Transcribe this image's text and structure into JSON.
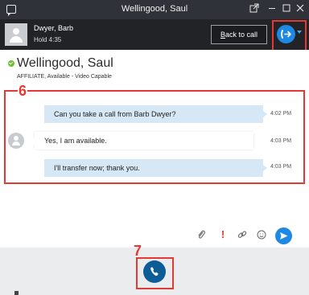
{
  "window": {
    "title": "Wellingood, Saul"
  },
  "call_bar": {
    "caller_name": "Dwyer, Barb",
    "hold_status": "Hold 4:35",
    "back_to_call_prefix": "B",
    "back_to_call_rest": "ack to call"
  },
  "contact": {
    "name": "Wellingood, Saul",
    "status_line": "AFFILIATE,  Available - Video Capable",
    "presence_color": "#6cbf2e"
  },
  "annotations": {
    "step6": "6",
    "step7": "7",
    "highlight_color": "#e53935"
  },
  "messages": [
    {
      "direction": "out",
      "text": "Can you take a call from Barb Dwyer?",
      "time": "4:02 PM"
    },
    {
      "direction": "in",
      "text": "Yes, I am available.",
      "time": "4:03 PM"
    },
    {
      "direction": "out",
      "text": "I'll transfer now; thank you.",
      "time": "4:03 PM"
    }
  ],
  "composer": {
    "tools": [
      "paperclip-icon",
      "priority-icon",
      "link-icon",
      "emoji-icon"
    ],
    "send_icon": "send-icon"
  },
  "colors": {
    "accent": "#1e88e5",
    "call_button": "#0c5c98",
    "outgoing_bubble": "#d6e7f5"
  }
}
